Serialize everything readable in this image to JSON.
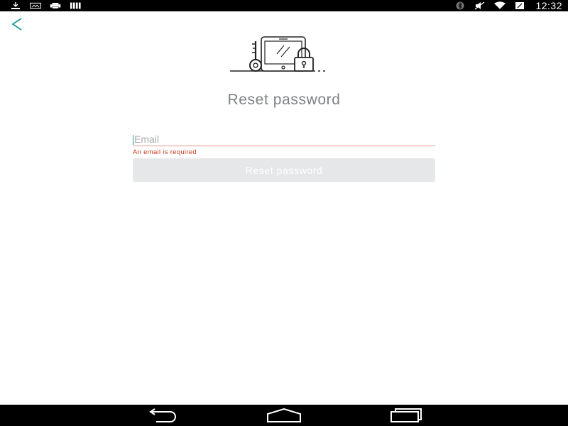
{
  "status_bar": {
    "left_icons": [
      "download-icon",
      "photo-icon",
      "print-icon",
      "storage-icon"
    ],
    "right_icons": [
      "bluetooth-icon",
      "mute-icon",
      "wifi-icon",
      "battery-icon"
    ],
    "time": "12:32"
  },
  "header": {
    "back_icon": "back-arrow-icon"
  },
  "illustration": {
    "icon": "phone-key-lock-icon"
  },
  "main": {
    "title": "Reset password",
    "email": {
      "value": "",
      "placeholder": "Email"
    },
    "error_message": "An email is required",
    "reset_button_label": "Reset password"
  },
  "nav_bar": {
    "icons": [
      "back-nav-icon",
      "home-nav-icon",
      "recents-nav-icon"
    ]
  },
  "colors": {
    "accent": "#1a9a93",
    "error": "#c63b1b",
    "title": "#7f8183",
    "button_bg": "#e6e7e8"
  }
}
